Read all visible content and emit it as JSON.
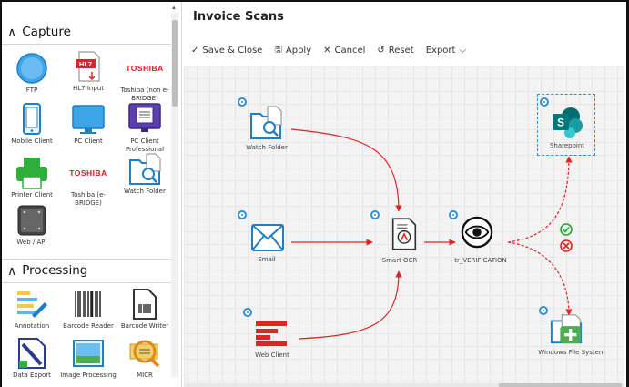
{
  "palette": {
    "sections": [
      {
        "title": "Capture",
        "tools": [
          "FTP",
          "HL7 Input",
          "Toshiba (non e-BRIDGE)",
          "Mobile Client",
          "PC Client",
          "PC Client Professional",
          "Printer Client",
          "Toshiba (e-BRIDGE)",
          "Watch Folder",
          "Web / API"
        ]
      },
      {
        "title": "Processing",
        "tools": [
          "Annotation",
          "Barcode Reader",
          "Barcode Writer",
          "Data Export",
          "Image Processing",
          "MICR"
        ]
      }
    ],
    "toshiba_logo": "TOSHIBA",
    "hl7_logo": "HL7"
  },
  "workflow": {
    "title": "Invoice Scans",
    "toolbar": [
      {
        "icon": "check-icon",
        "label": "Save & Close"
      },
      {
        "icon": "save-icon",
        "label": "Apply"
      },
      {
        "icon": "close-icon",
        "label": "Cancel"
      },
      {
        "icon": "reset-icon",
        "label": "Reset"
      },
      {
        "icon": "chevron-down-icon",
        "label": "Export"
      }
    ],
    "nodes": {
      "watch_folder": "Watch Folder",
      "email": "Email",
      "web_client": "Web Client",
      "smart_ocr": "Smart OCR",
      "verification": "tr_VERIFICATION",
      "sharepoint": "Sharepoint",
      "windows_fs": "Windows File System"
    },
    "sharepoint_letter": "S"
  },
  "colors": {
    "accent": "#2f8fd8",
    "edge": "#e02424",
    "approve": "#21a62b",
    "reject": "#e02424"
  }
}
